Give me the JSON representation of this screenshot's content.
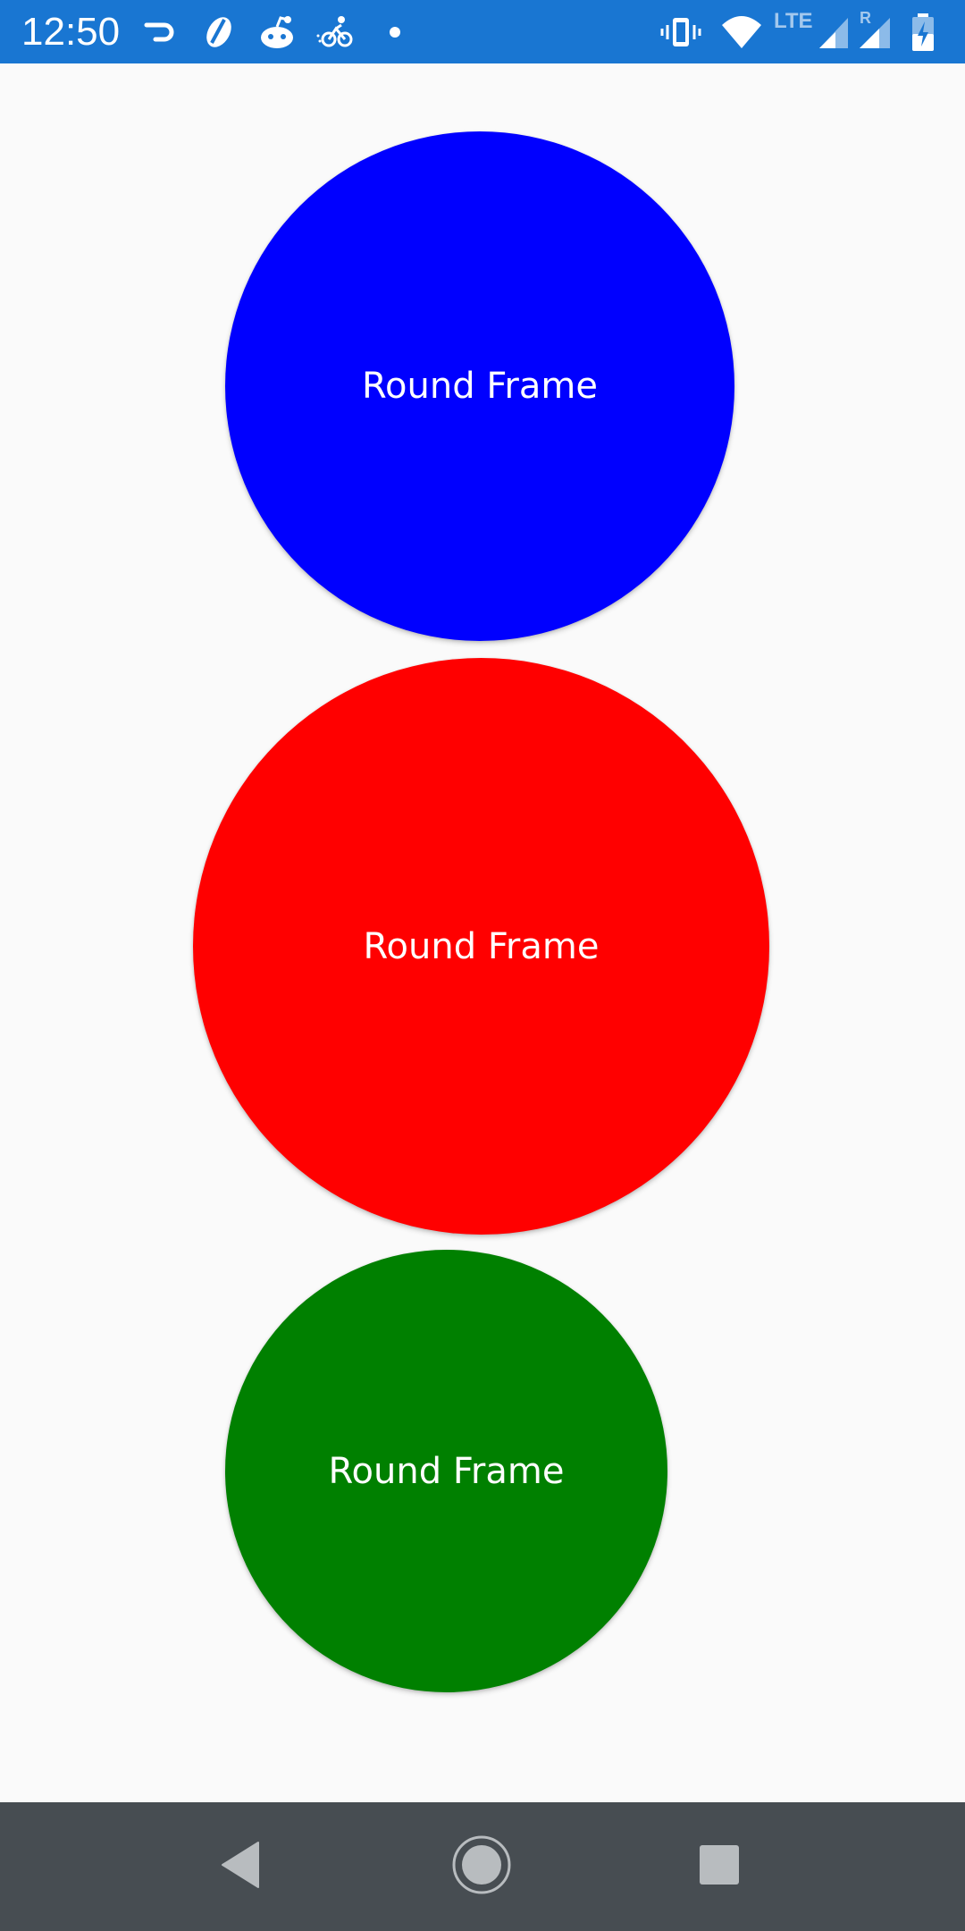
{
  "status_bar": {
    "time": "12:50",
    "network_label": "LTE",
    "roaming_label": "R",
    "background_color": "#1976d2",
    "left_icons": [
      "doordash-icon",
      "swoosh-app-icon",
      "reddit-icon",
      "cycling-app-icon",
      "dot-notification-icon"
    ],
    "right_icons": [
      "vibrate-icon",
      "wifi-icon",
      "signal-icon",
      "signal-roaming-icon",
      "battery-charging-icon"
    ]
  },
  "frames": [
    {
      "label": "Round Frame",
      "color": "#0000ff"
    },
    {
      "label": "Round Frame",
      "color": "#ff0000"
    },
    {
      "label": "Round Frame",
      "color": "#008000"
    }
  ],
  "nav_bar": {
    "background_color": "#474d52",
    "buttons": [
      "back-icon",
      "home-icon",
      "recents-icon"
    ]
  }
}
